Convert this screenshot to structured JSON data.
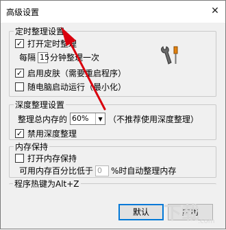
{
  "window": {
    "title": "高级设置",
    "close_symbol": "✕"
  },
  "timer_group": {
    "legend": "定时整理设置",
    "enable_timer": {
      "label": "打开定时整理",
      "checked": true
    },
    "interval_prefix": "每隔",
    "interval_value": "15",
    "interval_suffix": "分钟整理一次",
    "enable_skin": {
      "label": "启用皮肤（需要重启程序）",
      "checked": true
    },
    "autostart": {
      "label": "随电脑启动运行（最小化）",
      "checked": false
    },
    "tool_icon": "wrench-screwdriver-icon"
  },
  "depth_group": {
    "legend": "深度整理设置",
    "total_label": "整理总内存的",
    "percent_value": "60%",
    "note": "（不推荐使用深度整理）",
    "disable_deep": {
      "label": "禁用深度整理",
      "checked": true
    }
  },
  "hold_group": {
    "legend": "内存保持",
    "enable_hold": {
      "label": "打开内存保持",
      "checked": false
    },
    "threshold_prefix": "可用内存百分比低于",
    "threshold_value": "0",
    "threshold_suffix": "%时自动整理内存"
  },
  "hotkey_group": {
    "legend": "程序热键为Alt+Z"
  },
  "buttons": {
    "default_label": "默认",
    "apply_label": "应用"
  },
  "colors": {
    "arrow": "#d9000d",
    "accent": "#0078d7"
  }
}
